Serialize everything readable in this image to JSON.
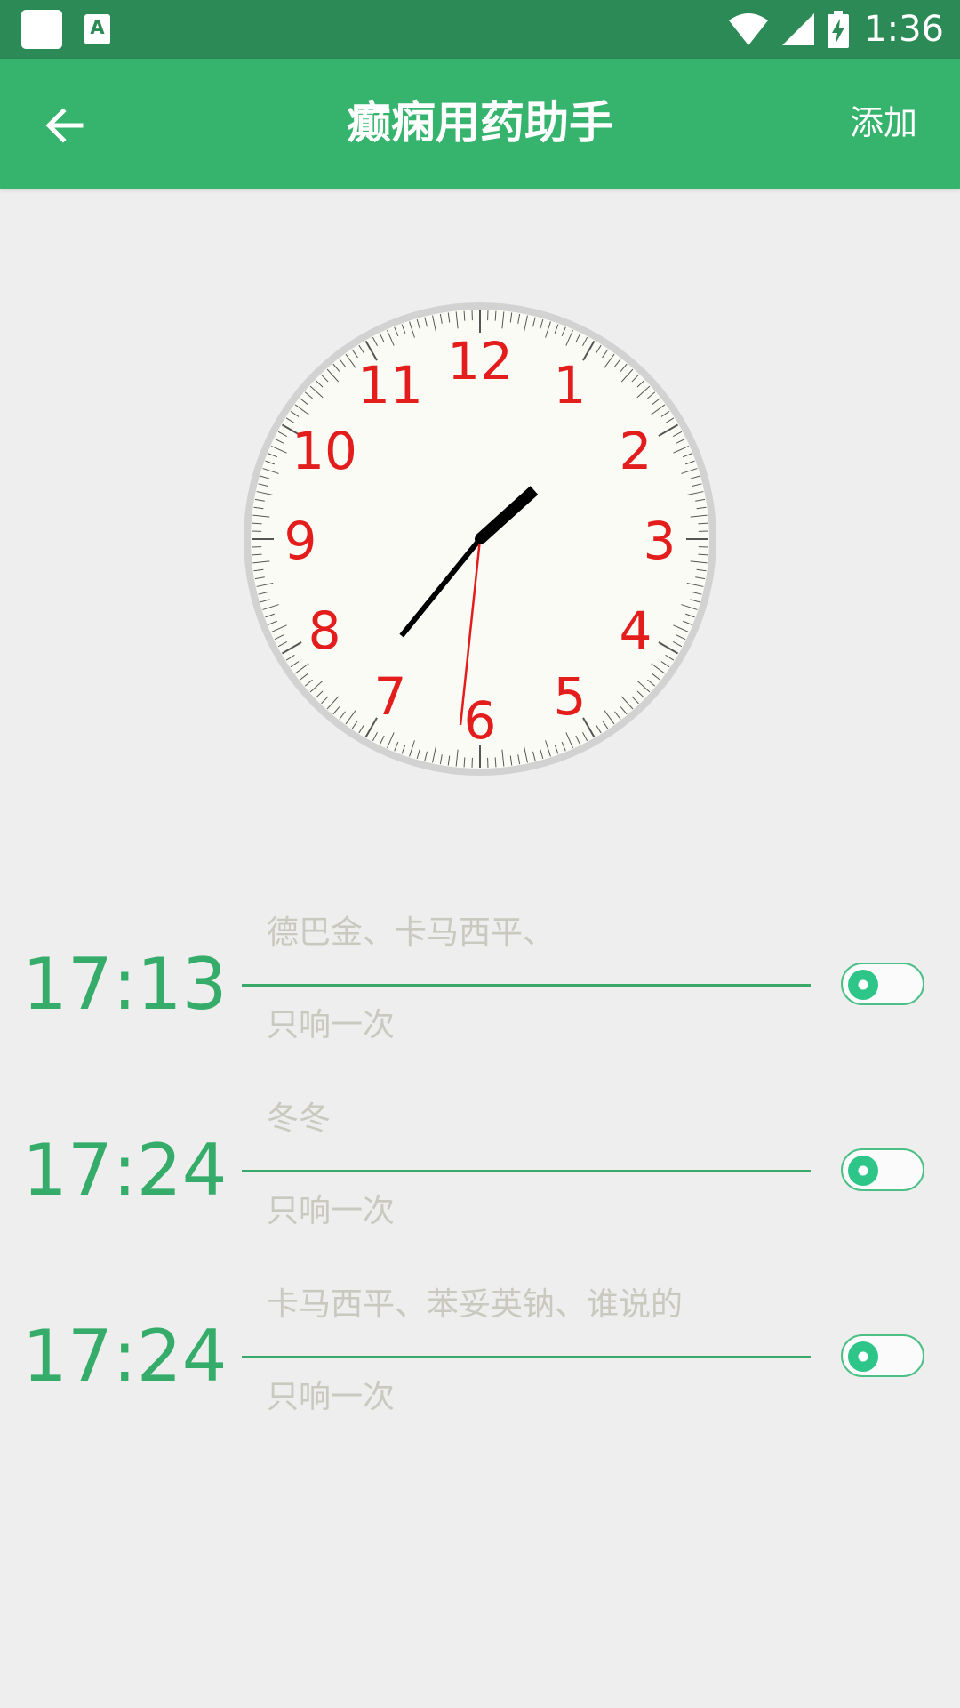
{
  "status_bar": {
    "time": "1:36",
    "notification_icon_label": "A"
  },
  "app_bar": {
    "title": "癫痫用药助手",
    "add_label": "添加"
  },
  "clock": {
    "numbers": [
      "12",
      "1",
      "2",
      "3",
      "4",
      "5",
      "6",
      "7",
      "8",
      "9",
      "10",
      "11"
    ],
    "number_color": "#e31c1c",
    "hand_color": "#000000",
    "second_hand_color": "#e31c1c",
    "hour": 1,
    "minute": 36,
    "second": 31
  },
  "alarms": [
    {
      "time": "17:13",
      "names": "德巴金、卡马西平、",
      "repeat": "只响一次",
      "enabled": false
    },
    {
      "time": "17:24",
      "names": "冬冬",
      "repeat": "只响一次",
      "enabled": false
    },
    {
      "time": "17:24",
      "names": "卡马西平、苯妥英钠、谁说的",
      "repeat": "只响一次",
      "enabled": false
    }
  ],
  "colors": {
    "status_bar": "#2b8a55",
    "app_bar": "#36b36c",
    "accent": "#36ac6b",
    "background": "#eeeeee"
  }
}
